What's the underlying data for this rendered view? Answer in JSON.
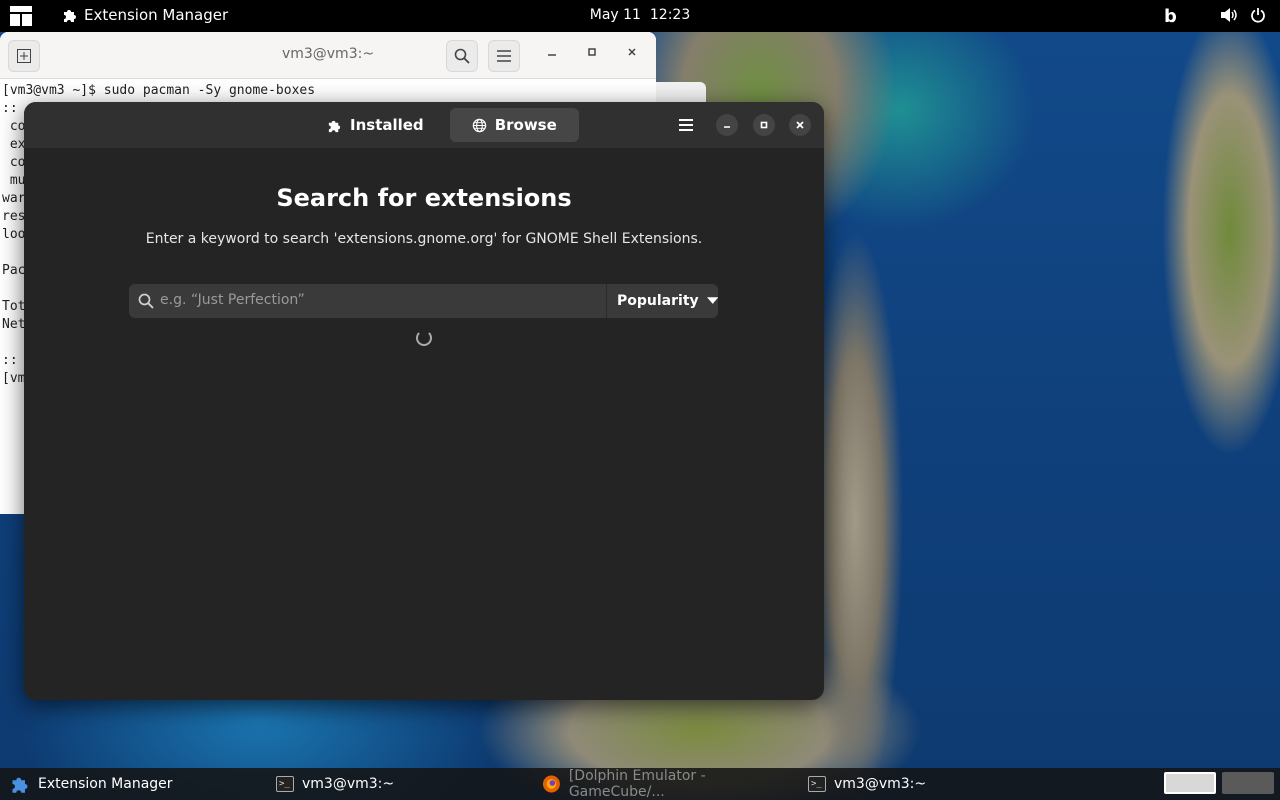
{
  "topbar": {
    "app_name": "Extension Manager",
    "date": "May 11",
    "time": "12:23",
    "tray_icons": [
      "bing-icon",
      "volume-icon",
      "power-icon"
    ]
  },
  "terminal": {
    "title": "vm3@vm3:~",
    "lines": [
      "[vm3@vm3 ~]$ sudo pacman -Sy gnome-boxes",
      ":: ",
      " co",
      " ex",
      " co",
      " mu",
      "war",
      "res",
      "loo",
      "",
      "Pac",
      "",
      "Tot",
      "Net",
      "",
      ":: ",
      "[vm"
    ]
  },
  "extension_manager": {
    "tabs": [
      {
        "label": "Installed",
        "icon": "puzzle-icon",
        "active": false
      },
      {
        "label": "Browse",
        "icon": "globe-icon",
        "active": true
      }
    ],
    "heading": "Search for extensions",
    "subtitle": "Enter a keyword to search 'extensions.gnome.org' for GNOME Shell Extensions.",
    "search": {
      "placeholder": "e.g. “Just Perfection”",
      "sort_label": "Popularity"
    },
    "loading": true
  },
  "taskbar": {
    "tasks": [
      {
        "label": "Extension Manager",
        "icon": "puzzle-icon",
        "state": "active"
      },
      {
        "label": "vm3@vm3:~",
        "icon": "terminal-icon",
        "state": "normal"
      },
      {
        "label": "[Dolphin Emulator - GameCube/...",
        "icon": "firefox-icon",
        "state": "minimized"
      },
      {
        "label": "vm3@vm3:~",
        "icon": "terminal-icon",
        "state": "normal"
      }
    ],
    "workspaces": [
      {
        "active": true
      },
      {
        "active": false
      }
    ]
  },
  "colors": {
    "accent_white": "#ffffff",
    "window_bg": "#242424",
    "headerbar_bg": "#303030",
    "active_tab": "#464646"
  }
}
